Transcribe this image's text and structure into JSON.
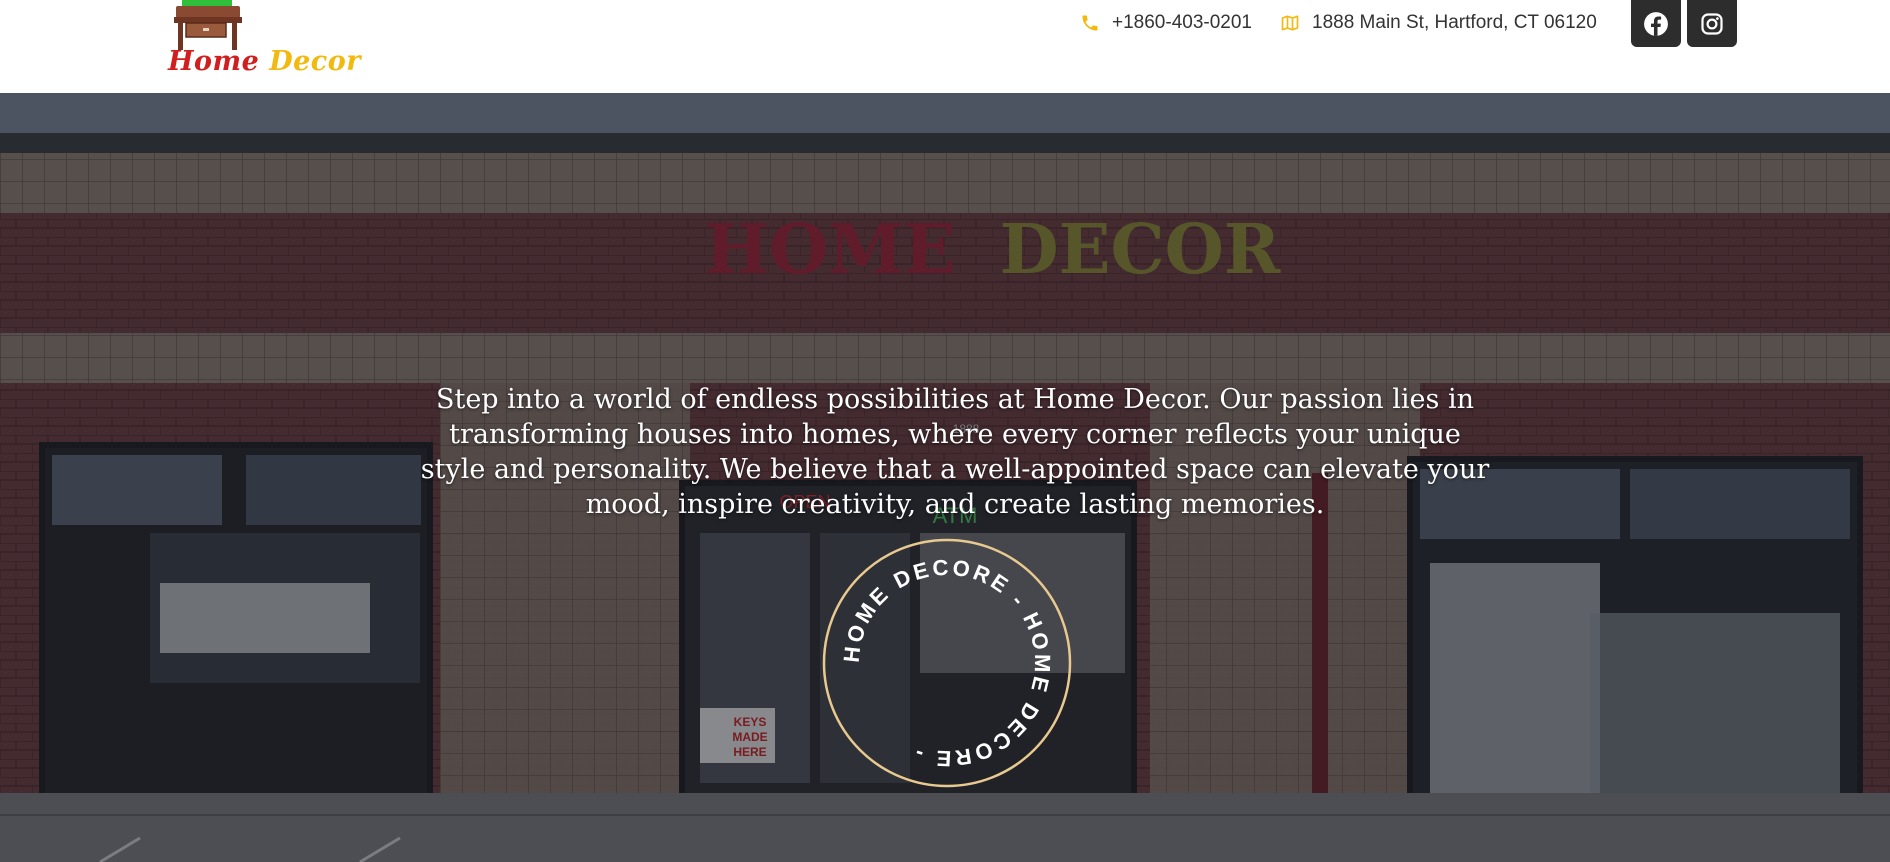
{
  "header": {
    "logo": {
      "word1": "Home",
      "word2": "Decor"
    },
    "phone": {
      "icon": "phone-icon",
      "text": "+1860-403-0201"
    },
    "address": {
      "icon": "map-icon",
      "text": "1888 Main St, Hartford, CT 06120"
    },
    "social": [
      {
        "name": "facebook",
        "icon": "facebook-icon"
      },
      {
        "name": "instagram",
        "icon": "instagram-icon"
      }
    ]
  },
  "hero": {
    "storefront_sign": {
      "word1": "HOME",
      "word2": "DECOR"
    },
    "description": "Step into a world of endless possibilities at Home Decor. Our passion lies in transforming houses into homes, where every corner reflects your unique style and personality. We believe that a well-appointed space can elevate your mood, inspire creativity, and create lasting memories.",
    "badge_text": "HOME DECORE - HOME DECORE - ",
    "scene_text": {
      "atm": "ATM",
      "open": "OPEN",
      "keys_line1": "KEYS",
      "keys_line2": "MADE",
      "keys_line3": "HERE",
      "number": "1888"
    }
  },
  "colors": {
    "accent_red": "#d11f1f",
    "accent_yellow": "#f2b90f",
    "icon_yellow": "#f2b90f",
    "social_bg": "#2d2d2d",
    "badge_ring": "#e8c98f"
  }
}
